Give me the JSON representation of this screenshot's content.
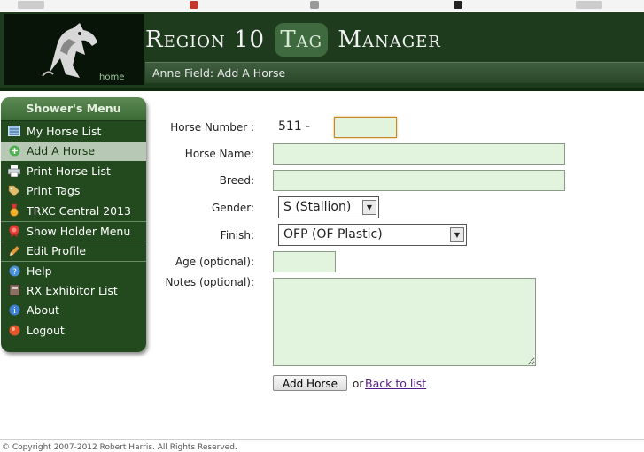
{
  "header": {
    "title_left": "Region 10",
    "title_tag": "Tag",
    "title_right": "Manager",
    "home_label": "home",
    "subtitle": "Anne Field: Add A Horse"
  },
  "sidebar": {
    "heading": "Shower's Menu",
    "items": [
      {
        "label": "My Horse List",
        "icon": "list-icon",
        "color": "#9bc4e6"
      },
      {
        "label": "Add A Horse",
        "icon": "plus-circle-icon",
        "color": "#4caf50"
      },
      {
        "label": "Print Horse List",
        "icon": "printer-icon",
        "color": "#cfd8dc"
      },
      {
        "label": "Print Tags",
        "icon": "tag-icon",
        "color": "#e0c070"
      },
      {
        "label": "TRXC Central 2013",
        "icon": "medal-icon",
        "color": "#f0b030"
      },
      {
        "label": "Show Holder Menu",
        "icon": "rosette-icon",
        "color": "#e53935"
      },
      {
        "label": "Edit Profile",
        "icon": "pencil-icon",
        "color": "#e0a040"
      },
      {
        "label": "Help",
        "icon": "help-icon",
        "color": "#4a90d9"
      },
      {
        "label": "RX Exhibitor List",
        "icon": "book-icon",
        "color": "#8d6e63"
      },
      {
        "label": "About",
        "icon": "info-icon",
        "color": "#3f7fd0"
      },
      {
        "label": "Logout",
        "icon": "logout-icon",
        "color": "#e8542a"
      }
    ]
  },
  "form": {
    "horse_number_label": "Horse Number :",
    "horse_number_prefix": "511 -",
    "horse_number_value": "",
    "horse_name_label": "Horse Name:",
    "horse_name_value": "",
    "breed_label": "Breed:",
    "breed_value": "",
    "gender_label": "Gender:",
    "gender_value": "S (Stallion)",
    "finish_label": "Finish:",
    "finish_value": "OFP (OF Plastic)",
    "age_label": "Age (optional):",
    "age_value": "",
    "notes_label": "Notes (optional):",
    "notes_value": "",
    "submit_label": "Add Horse",
    "or_text": "or",
    "back_link": "Back to list"
  },
  "footer": {
    "copyright": "© Copyright 2007-2012 Robert Harris. All Rights Reserved."
  },
  "colors": {
    "header_bg": "#1e3b1e",
    "sidebar_bg": "#234a1f",
    "field_bg": "#e2f3de",
    "link": "#551a8b"
  }
}
